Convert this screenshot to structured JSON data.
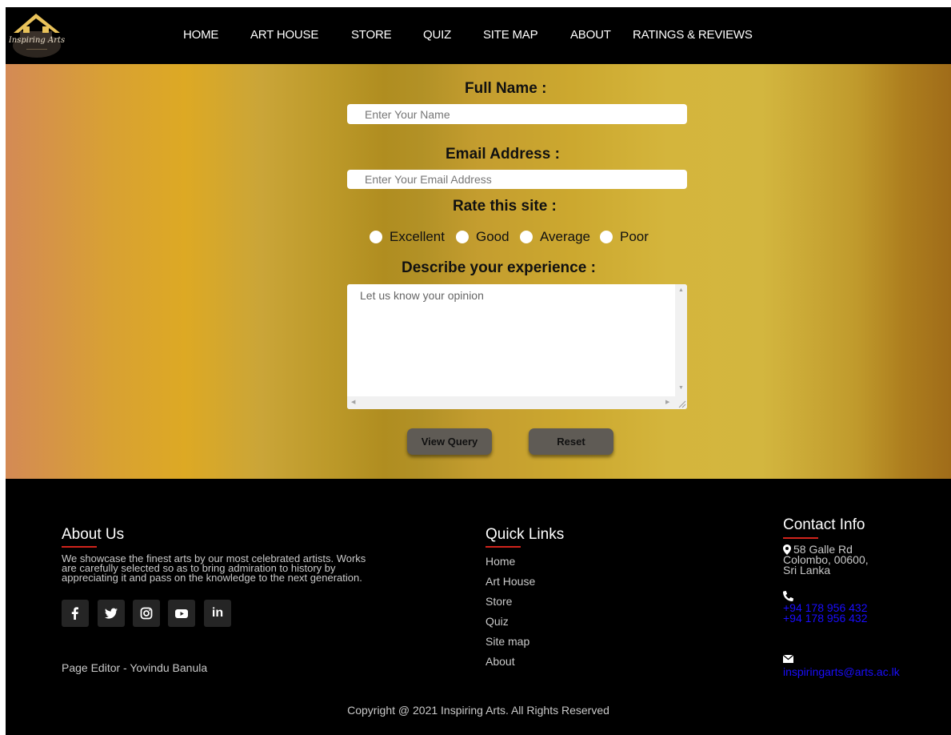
{
  "nav": {
    "logo_text": "Inspiring Arts",
    "links": [
      "HOME",
      "ART HOUSE",
      "STORE",
      "QUIZ",
      "SITE MAP",
      "ABOUT",
      "RATINGS & REVIEWS"
    ]
  },
  "form": {
    "full_name_label": "Full Name :",
    "full_name_placeholder": "Enter Your Name",
    "email_label": "Email Address :",
    "email_placeholder": "Enter Your Email Address",
    "rate_label": "Rate this site :",
    "rate_options": [
      "Excellent",
      "Good",
      "Average",
      "Poor"
    ],
    "experience_label": "Describe your experience :",
    "experience_placeholder": "Let us know your opinion",
    "view_query_label": "View Query",
    "reset_label": "Reset"
  },
  "footer": {
    "about_heading": "About Us",
    "about_lines": [
      "We showcase the finest arts by our most celebrated artists. Works",
      "are carefully selected so as to bring admiration to history by",
      "appreciating it and pass on the knowledge to the next generation."
    ],
    "social_icons": [
      "facebook-icon",
      "twitter-icon",
      "instagram-icon",
      "youtube-icon",
      "linkedin-icon"
    ],
    "linkedin_text": "in",
    "editor": "Page Editor - Yovindu Banula",
    "quick_links_heading": "Quick Links",
    "quick_links": [
      "Home",
      "Art House",
      "Store",
      "Quiz",
      "Site map",
      "About"
    ],
    "contact_heading": "Contact Info",
    "address_lines": [
      "58 Galle Rd",
      "Colombo, 00600,",
      "Sri Lanka"
    ],
    "phones": [
      "+94 178 956 432",
      "+94 178 956 432"
    ],
    "email": "inspiringarts@arts.ac.lk",
    "copyright": "Copyright @ 2021 Inspiring Arts. All Rights Reserved"
  },
  "colors": {
    "nav_bg": "#000000",
    "footer_bg": "#000000",
    "accent_underline": "#d1241c",
    "link_blue": "#1a0dff",
    "button_bg": "#5f5b55"
  }
}
